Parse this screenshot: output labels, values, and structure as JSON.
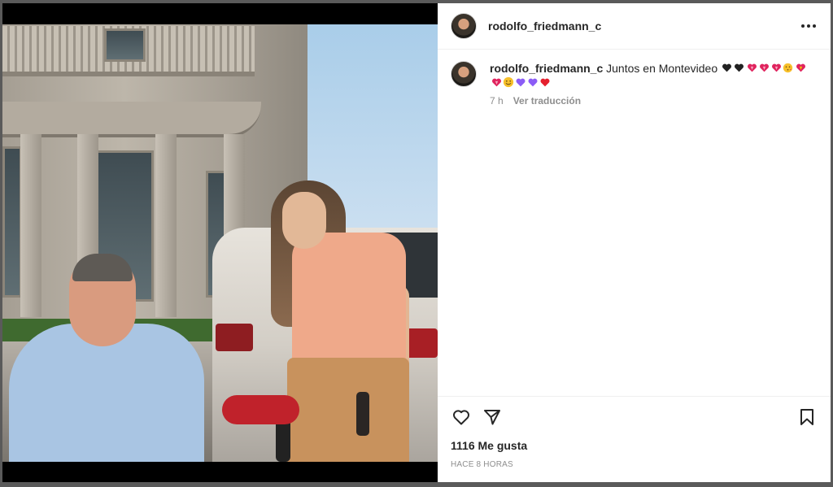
{
  "post": {
    "username": "rodolfo_friedmann_c",
    "caption": {
      "username": "rodolfo_friedmann_c",
      "text": "Juntos en Montevideo",
      "emojis_line1": [
        "black-heart",
        "black-heart",
        "heart-exclamation",
        "heart-exclamation",
        "heart-exclamation",
        "kissing-face",
        "heart-exclamation"
      ],
      "emojis_line2": [
        "heart-exclamation",
        "smiling-face",
        "purple-heart",
        "purple-heart",
        "red-heart"
      ]
    },
    "comment_age": "7 h",
    "translate_label": "Ver traducción",
    "likes_label": "1116 Me gusta",
    "timestamp": "HACE 8 HORAS"
  },
  "colors": {
    "text": "#262626",
    "secondary": "#8e8e8e",
    "divider": "#efefef",
    "backdrop": "#5a5a5a"
  },
  "icons": {
    "more": "more-horizontal-icon",
    "like": "heart-outline-icon",
    "share": "paper-plane-icon",
    "save": "bookmark-icon"
  }
}
